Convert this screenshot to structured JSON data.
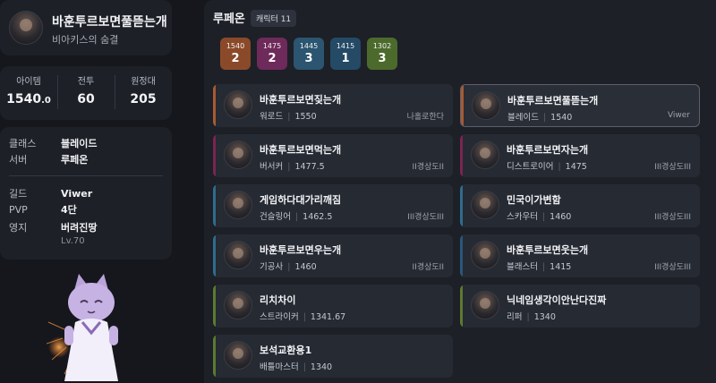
{
  "profile": {
    "name": "바훈투르보면풀뜯는개",
    "subtitle": "비아키스의 숨결"
  },
  "stats": [
    {
      "label": "아이템",
      "value_main": "1540",
      "value_dec": ".0"
    },
    {
      "label": "전투",
      "value_main": "60",
      "value_dec": ""
    },
    {
      "label": "원정대",
      "value_main": "205",
      "value_dec": ""
    }
  ],
  "info": {
    "class_label": "클래스",
    "class_value": "블레이드",
    "server_label": "서버",
    "server_value": "루페온",
    "guild_label": "길드",
    "guild_value": "Viwer",
    "pvp_label": "PVP",
    "pvp_value": "4단",
    "estate_label": "영지",
    "estate_value": "버려진땅",
    "estate_level": "Lv.70"
  },
  "roster": {
    "server": "루페온",
    "count_label": "캐릭터 11",
    "levels": [
      {
        "level": "1540",
        "count": "2",
        "color": "#8a4a2a"
      },
      {
        "level": "1475",
        "count": "2",
        "color": "#6e2a5a"
      },
      {
        "level": "1445",
        "count": "3",
        "color": "#2b5570"
      },
      {
        "level": "1415",
        "count": "1",
        "color": "#244a66"
      },
      {
        "level": "1302",
        "count": "3",
        "color": "#4c6a2c"
      }
    ],
    "characters": [
      {
        "name": "바훈투르보면짖는개",
        "class": "워로드",
        "level": "1550",
        "guild": "나홀로한다",
        "bar": "#a85a32"
      },
      {
        "name": "바훈투르보면풀뜯는개",
        "class": "블레이드",
        "level": "1540",
        "guild": "Viwer",
        "bar": "#a85a32",
        "selected": true
      },
      {
        "name": "바훈투르보면먹는개",
        "class": "버서커",
        "level": "1477.5",
        "guild": "II경상도II",
        "bar": "#7a2452"
      },
      {
        "name": "바훈투르보면자는개",
        "class": "디스트로이어",
        "level": "1475",
        "guild": "III경상도III",
        "bar": "#7a2452"
      },
      {
        "name": "게임하다대가리깨짐",
        "class": "건슬링어",
        "level": "1462.5",
        "guild": "III경상도III",
        "bar": "#2f6c8c"
      },
      {
        "name": "민국이가변함",
        "class": "스카우터",
        "level": "1460",
        "guild": "III경상도III",
        "bar": "#2f6c8c"
      },
      {
        "name": "바훈투르보면우는개",
        "class": "기공사",
        "level": "1460",
        "guild": "II경상도II",
        "bar": "#2f6c8c"
      },
      {
        "name": "바훈투르보면웃는개",
        "class": "블래스터",
        "level": "1415",
        "guild": "III경상도III",
        "bar": "#2a5878"
      },
      {
        "name": "리치차이",
        "class": "스트라이커",
        "level": "1341.67",
        "guild": "",
        "bar": "#5c7a30"
      },
      {
        "name": "닉네임생각이안난다진짜",
        "class": "리퍼",
        "level": "1340",
        "guild": "",
        "bar": "#5c7a30"
      },
      {
        "name": "보석교환용1",
        "class": "배틀마스터",
        "level": "1340",
        "guild": "",
        "bar": "#5c7a30"
      }
    ]
  }
}
